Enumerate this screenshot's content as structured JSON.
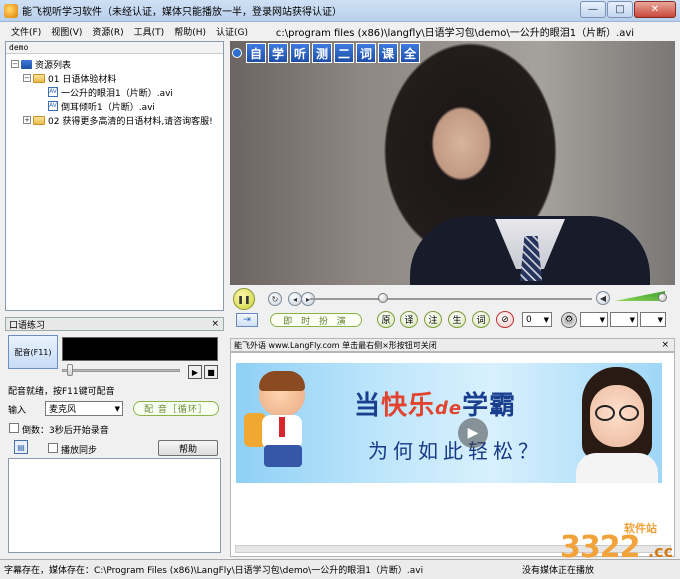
{
  "window": {
    "title": "能飞视听学习软件（未经认证，媒体只能播放一半，登录网站获得认证）",
    "controls": {
      "minimize": "—",
      "maximize": "□",
      "close": "✕"
    }
  },
  "menu": [
    "文件(F)",
    "视图(V)",
    "资源(R)",
    "工具(T)",
    "帮助(H)",
    "认证(G)"
  ],
  "current_file": "c:\\program files (x86)\\langfly\\日语学习包\\demo\\一公升的眼泪1（片断）.avi",
  "tree": {
    "header": "demo",
    "root": "资源列表",
    "folder1": "01 日语体验材料",
    "item1": "一公升的眼泪1（片断）.avi",
    "item2": "倒耳倾听1（片断）.avi",
    "folder2": "02 获得更多高清的日语材料,请咨询客服!",
    "video_badge": "AV"
  },
  "practice": {
    "title": "口语练习",
    "close": "×",
    "dub_button": "配音(F11)",
    "status": "配音就绪，按F11键可配音",
    "input_label": "输入",
    "input_value": "麦克风",
    "dub_loop": "配 音［循环］",
    "countdown": "倒数：3秒后开始录音",
    "sync_label": "播放同步",
    "help": "帮助"
  },
  "player": {
    "banner": [
      "自",
      "学",
      "听",
      "测",
      "二",
      "词",
      "课",
      "全"
    ],
    "mode": "即 时 扮 演",
    "buttons": [
      "原",
      "译",
      "注",
      "生",
      "词"
    ],
    "speed_value": "0",
    "progress": 0.26,
    "volume": 1.0
  },
  "ad": {
    "header": "能飞外语 www.LangFly.com 单击最右侧×形按钮可关闭",
    "close": "×",
    "title_a": "当",
    "title_hl": "快乐",
    "title_de": "de",
    "title_b": "学霸",
    "subtitle": "为何如此轻松？"
  },
  "status": {
    "left": "字幕存在，媒体存在：C:\\Program Files (x86)\\LangFly\\日语学习包\\demo\\一公升的眼泪1（片断）.avi",
    "right": "没有媒体正在播放"
  },
  "watermark": {
    "main": "3322",
    "site": "软件站",
    "suffix": ".cc"
  }
}
